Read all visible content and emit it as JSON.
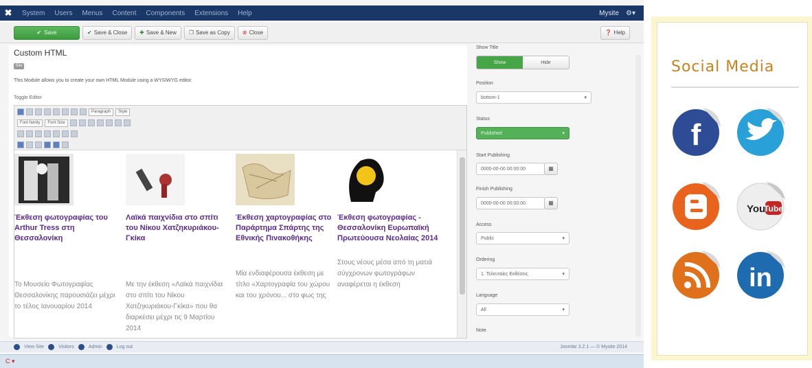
{
  "topbar": {
    "menu": [
      "System",
      "Users",
      "Menus",
      "Content",
      "Components",
      "Extensions",
      "Help"
    ],
    "user": "Mysite",
    "gear": "gear-icon"
  },
  "toolbar": {
    "save": "Save",
    "save_close": "Save & Close",
    "save_new": "Save & New",
    "save_copy": "Save as Copy",
    "close": "Close",
    "help": "Help"
  },
  "module": {
    "title": "Custom HTML",
    "badge": "Site",
    "description": "This Module allows you to create your own HTML Module using a WYSIWYG editor.",
    "toggle": "Toggle Editor",
    "paragraph": "Paragraph",
    "font_size": "Font Size",
    "font_family": "Font family",
    "font_style": "Style"
  },
  "articles": [
    {
      "heading": "Έκθεση φωτογραφίας του Arthur Tress στη Θεσσαλονίκη",
      "text": "Το Μουσείο Φωτογραφίας Θεσσαλονίκης παρουσιάζει μέχρι το τέλος Ιανουαρίου 2014"
    },
    {
      "heading": "Λαϊκά παιχνίδια στο σπίτι του Νίκου Χατζηκυριάκου-Γκίκα",
      "text": "Με την έκθεση «Λαϊκά παιχνίδια στο σπίτι του Νίκου Χατζηκυριάκου-Γκίκα» που θα διαρκέσει μέχρι τις 9 Μαρτίου 2014"
    },
    {
      "heading": "Έκθεση χαρτογραφίας στο Παράρτημα Σπάρτης της Εθνικής Πινακοθήκης",
      "text": "Μία ενδιαφέρουσα έκθεση με τίτλο «Χαρτογραφία του χώρου και του χρόνου... στο φως της"
    },
    {
      "heading": "Έκθεση φωτογραφίας - Θεσσαλονίκη Ευρωπαϊκή Πρωτεύουσα Νεολαίας 2014",
      "text": "Στους νέους μέσα από τη ματιά σύγχρονων φωτογράφων αναφέρεται η έκθεση"
    }
  ],
  "options": {
    "show_title_label": "Show Title",
    "show": "Show",
    "hide": "Hide",
    "position_label": "Position",
    "position_value": "bottom-1",
    "status_label": "Status",
    "status_value": "Published",
    "start_label": "Start Publishing",
    "start_value": "0000-00-00 00:00:00",
    "finish_label": "Finish Publishing",
    "finish_value": "0000-00-00 00:00:00",
    "access_label": "Access",
    "access_value": "Public",
    "ordering_label": "Ordering",
    "ordering_value": "1. Τελευταίες Εκθέσεις",
    "language_label": "Language",
    "language_value": "All",
    "note_label": "Note"
  },
  "statusbar": {
    "items": [
      "View Site",
      "Visitors",
      "Admin",
      "Log out"
    ],
    "right": "Joomla! 3.2.1 — © Mysite 2014",
    "taskbar": "C"
  },
  "social": {
    "title": "Social Media",
    "icons": [
      "facebook-icon",
      "twitter-icon",
      "blogger-icon",
      "youtube-icon",
      "rss-icon",
      "linkedin-icon"
    ],
    "youtube_text": "You Tube",
    "linkedin_text": "in",
    "facebook_text": "f",
    "blogger_text": "B",
    "colors": {
      "facebook": "#2d4c95",
      "twitter": "#2aa0d8",
      "blogger": "#e8641c",
      "youtube": "#c22626",
      "rss": "#e0711c",
      "linkedin": "#1f6bb0",
      "title": "#c5841f"
    }
  }
}
